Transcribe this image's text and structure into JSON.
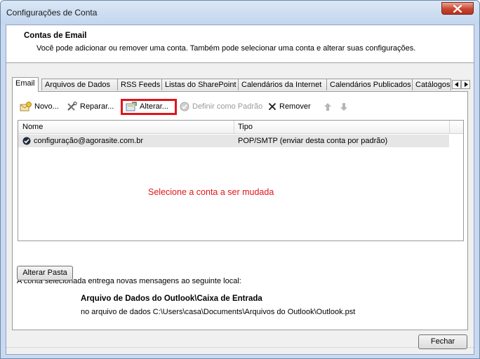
{
  "window": {
    "title": "Configurações de Conta"
  },
  "header": {
    "title": "Contas de Email",
    "description": "Você pode adicionar ou remover uma conta. Também pode selecionar uma conta e alterar suas configurações."
  },
  "tabs": [
    {
      "label": "Email",
      "active": true
    },
    {
      "label": "Arquivos de Dados",
      "active": false
    },
    {
      "label": "RSS Feeds",
      "active": false
    },
    {
      "label": "Listas do SharePoint",
      "active": false
    },
    {
      "label": "Calendários da Internet",
      "active": false
    },
    {
      "label": "Calendários Publicados",
      "active": false
    },
    {
      "label": "Catálogos",
      "active": false
    }
  ],
  "toolbar": {
    "new_label": "Novo...",
    "repair_label": "Reparar...",
    "change_label": "Alterar...",
    "set_default_label": "Definir como Padrão",
    "remove_label": "Remover"
  },
  "accounts_table": {
    "columns": [
      "Nome",
      "Tipo"
    ],
    "rows": [
      {
        "name": "configuração@agorasite.com.br",
        "type": "POP/SMTP (enviar desta conta por padrão)"
      }
    ]
  },
  "annotation": {
    "text": "Selecione a conta a ser mudada",
    "color": "#e0141c"
  },
  "delivery": {
    "label": "A conta selecionada entrega novas mensagens ao seguinte local:",
    "change_folder_label": "Alterar Pasta",
    "folder_title": "Arquivo de Dados do Outlook\\Caixa de Entrada",
    "folder_path": "no arquivo de dados C:\\Users\\casa\\Documents\\Arquivos do Outlook\\Outlook.pst"
  },
  "footer": {
    "close_label": "Fechar"
  }
}
